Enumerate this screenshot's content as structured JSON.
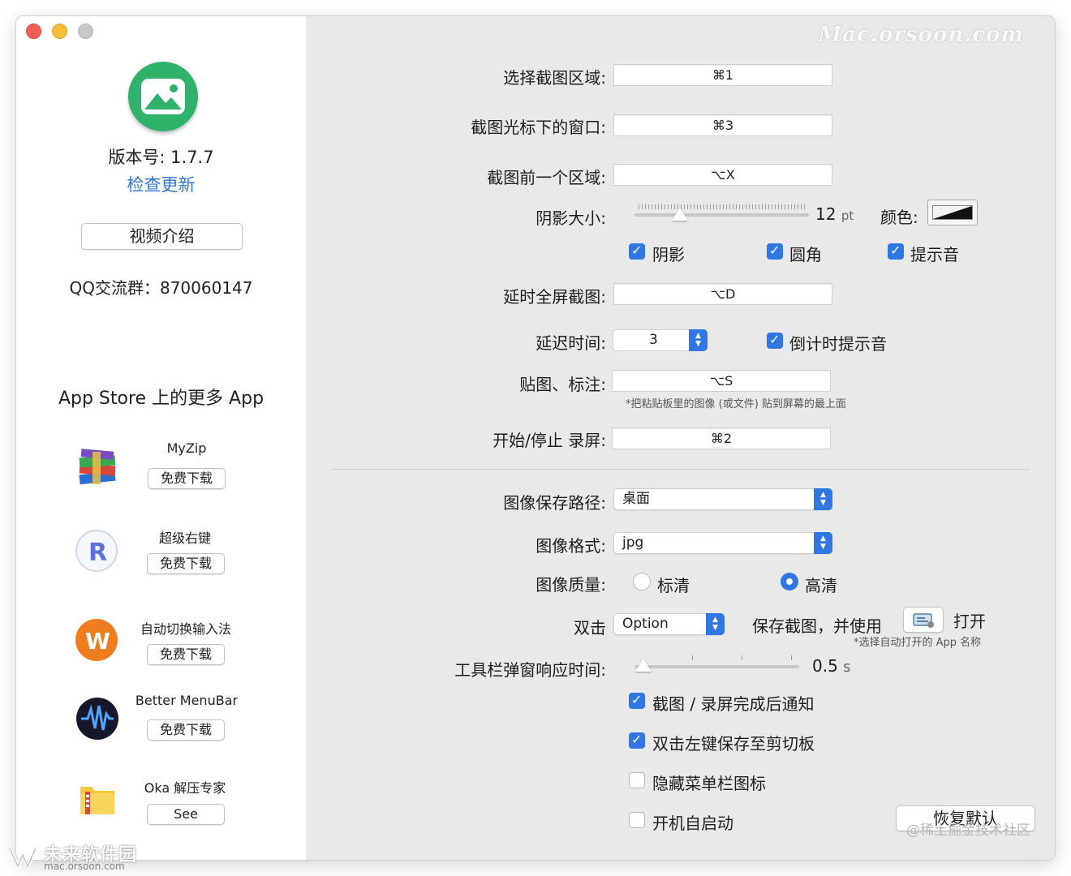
{
  "window": {
    "watermark": "Mac.orsoon.com"
  },
  "sidebar": {
    "version": "版本号: 1.7.7",
    "check_update": "检查更新",
    "video_button": "视频介绍",
    "qq_group": "QQ交流群：870060147",
    "more_apps_title": "App Store 上的更多 App",
    "apps": [
      {
        "name": "MyZip",
        "button": "免费下载",
        "icon": "books-stack-icon"
      },
      {
        "name": "超级右键",
        "button": "免费下载",
        "icon": "r-logo-icon"
      },
      {
        "name": "自动切换输入法",
        "button": "免费下载",
        "icon": "w-logo-icon"
      },
      {
        "name": "Better MenuBar",
        "button": "免费下载",
        "icon": "waveform-icon"
      },
      {
        "name": "Oka 解压专家",
        "button": "See",
        "icon": "zip-folder-icon"
      }
    ]
  },
  "main": {
    "select_region": {
      "label": "选择截图区域:",
      "value": "⌘1"
    },
    "window_under_cursor": {
      "label": "截图光标下的窗口:",
      "value": "⌘3"
    },
    "previous_region": {
      "label": "截图前一个区域:",
      "value": "⌥X"
    },
    "shadow": {
      "label": "阴影大小:",
      "value": "12",
      "unit": "pt",
      "color_label": "颜色:",
      "slider_fraction": 0.27
    },
    "toggles1": [
      {
        "label": "阴影",
        "checked": true
      },
      {
        "label": "圆角",
        "checked": true
      },
      {
        "label": "提示音",
        "checked": true
      }
    ],
    "delayed_fullscreen": {
      "label": "延时全屏截图:",
      "value": "⌥D"
    },
    "delay_time": {
      "label": "延迟时间:",
      "value": "3",
      "countdown_label": "倒计时提示音",
      "countdown_checked": true
    },
    "paste_annotate": {
      "label": "贴图、标注:",
      "value": "⌥S",
      "note": "*把粘贴板里的图像 (或文件) 贴到屏幕的最上面"
    },
    "record": {
      "label": "开始/停止 录屏:",
      "value": "⌘2"
    },
    "save_path": {
      "label": "图像保存路径:",
      "value": "桌面"
    },
    "format": {
      "label": "图像格式:",
      "value": "jpg"
    },
    "quality": {
      "label": "图像质量:",
      "options": [
        "标清",
        "高清"
      ],
      "selected": "高清"
    },
    "double_click": {
      "label": "双击",
      "modifier": "Option",
      "text": "保存截图，并使用",
      "open_label": "打开",
      "note": "*选择自动打开的 App 名称"
    },
    "toolbar_delay": {
      "label": "工具栏弹窗响应时间:",
      "value": "0.5",
      "unit": "s",
      "slider_fraction": 0.0
    },
    "options": [
      {
        "label": "截图 / 录屏完成后通知",
        "checked": true
      },
      {
        "label": "双击左键保存至剪切板",
        "checked": true
      },
      {
        "label": "隐藏菜单栏图标",
        "checked": false
      },
      {
        "label": "开机自启动",
        "checked": false
      }
    ],
    "restore_button": "恢复默认"
  },
  "overlay": {
    "juejin": "@稀土掘金技术社区",
    "corner_brand": "未来软件园",
    "corner_url": "mac.orsoon.com"
  },
  "colors": {
    "accent": "#2f77e4",
    "app_icon": "#2fb36a",
    "link": "#2f77d8"
  }
}
